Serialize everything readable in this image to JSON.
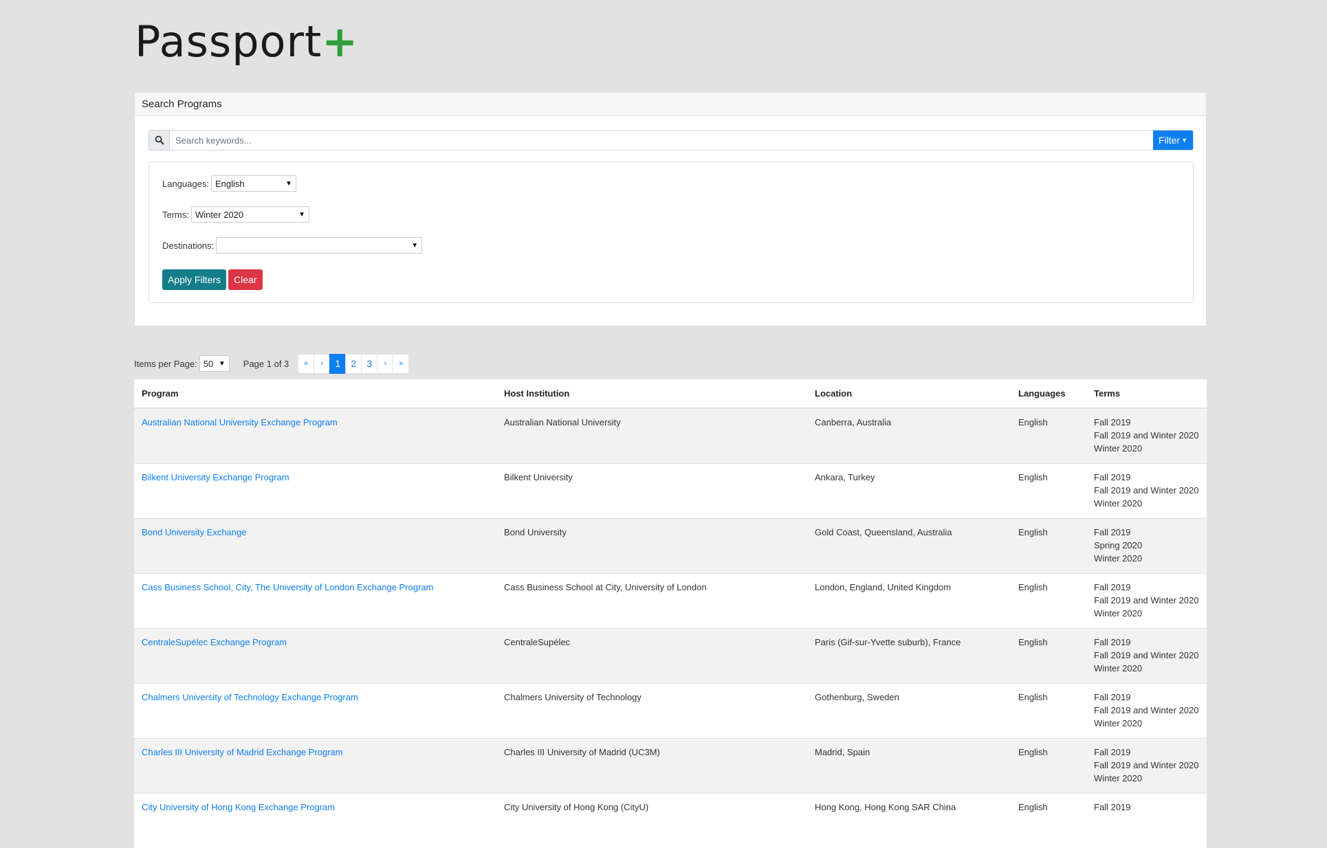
{
  "logo": {
    "text": "Passport",
    "plus": "+"
  },
  "search_card": {
    "header": "Search Programs",
    "search_placeholder": "Search keywords...",
    "filter_label": "Filter",
    "filters": {
      "languages_label": "Languages:",
      "languages_value": "English",
      "terms_label": "Terms:",
      "terms_value": "Winter 2020",
      "destinations_label": "Destinations:",
      "destinations_value": ""
    },
    "apply_label": "Apply Filters",
    "clear_label": "Clear"
  },
  "pager": {
    "items_per_page_label": "Items per Page:",
    "items_per_page_value": "50",
    "page_info": "Page 1 of 3",
    "first": "«",
    "prev": "‹",
    "pages": [
      "1",
      "2",
      "3"
    ],
    "active_page": "1",
    "next": "›",
    "last": "»"
  },
  "table": {
    "headers": [
      "Program",
      "Host Institution",
      "Location",
      "Languages",
      "Terms"
    ],
    "rows": [
      {
        "program": "Australian National University Exchange Program",
        "host": "Australian National University",
        "location": "Canberra, Australia",
        "languages": "English",
        "terms": [
          "Fall 2019",
          "Fall 2019 and Winter 2020",
          "Winter 2020"
        ]
      },
      {
        "program": "Bilkent University Exchange Program",
        "host": "Bilkent University",
        "location": "Ankara, Turkey",
        "languages": "English",
        "terms": [
          "Fall 2019",
          "Fall 2019 and Winter 2020",
          "Winter 2020"
        ]
      },
      {
        "program": "Bond University Exchange",
        "host": "Bond University",
        "location": "Gold Coast, Queensland, Australia",
        "languages": "English",
        "terms": [
          "Fall 2019",
          "Spring 2020",
          "Winter 2020"
        ]
      },
      {
        "program": "Cass Business School, City, The University of London Exchange Program",
        "host": "Cass Business School at City, University of London",
        "location": "London, England, United Kingdom",
        "languages": "English",
        "terms": [
          "Fall 2019",
          "Fall 2019 and Winter 2020",
          "Winter 2020"
        ]
      },
      {
        "program": "CentraleSupélec Exchange Program",
        "host": "CentraleSupélec",
        "location": "Paris (Gif-sur-Yvette suburb), France",
        "languages": "English",
        "terms": [
          "Fall 2019",
          "Fall 2019 and Winter 2020",
          "Winter 2020"
        ]
      },
      {
        "program": "Chalmers University of Technology Exchange Program",
        "host": "Chalmers University of Technology",
        "location": "Gothenburg, Sweden",
        "languages": "English",
        "terms": [
          "Fall 2019",
          "Fall 2019 and Winter 2020",
          "Winter 2020"
        ]
      },
      {
        "program": "Charles III University of Madrid Exchange Program",
        "host": "Charles III University of Madrid (UC3M)",
        "location": "Madrid, Spain",
        "languages": "English",
        "terms": [
          "Fall 2019",
          "Fall 2019 and Winter 2020",
          "Winter 2020"
        ]
      },
      {
        "program": "City University of Hong Kong Exchange Program",
        "host": "City University of Hong Kong (CityU)",
        "location": "Hong Kong, Hong Kong SAR China",
        "languages": "English",
        "terms": [
          "Fall 2019"
        ]
      }
    ]
  }
}
